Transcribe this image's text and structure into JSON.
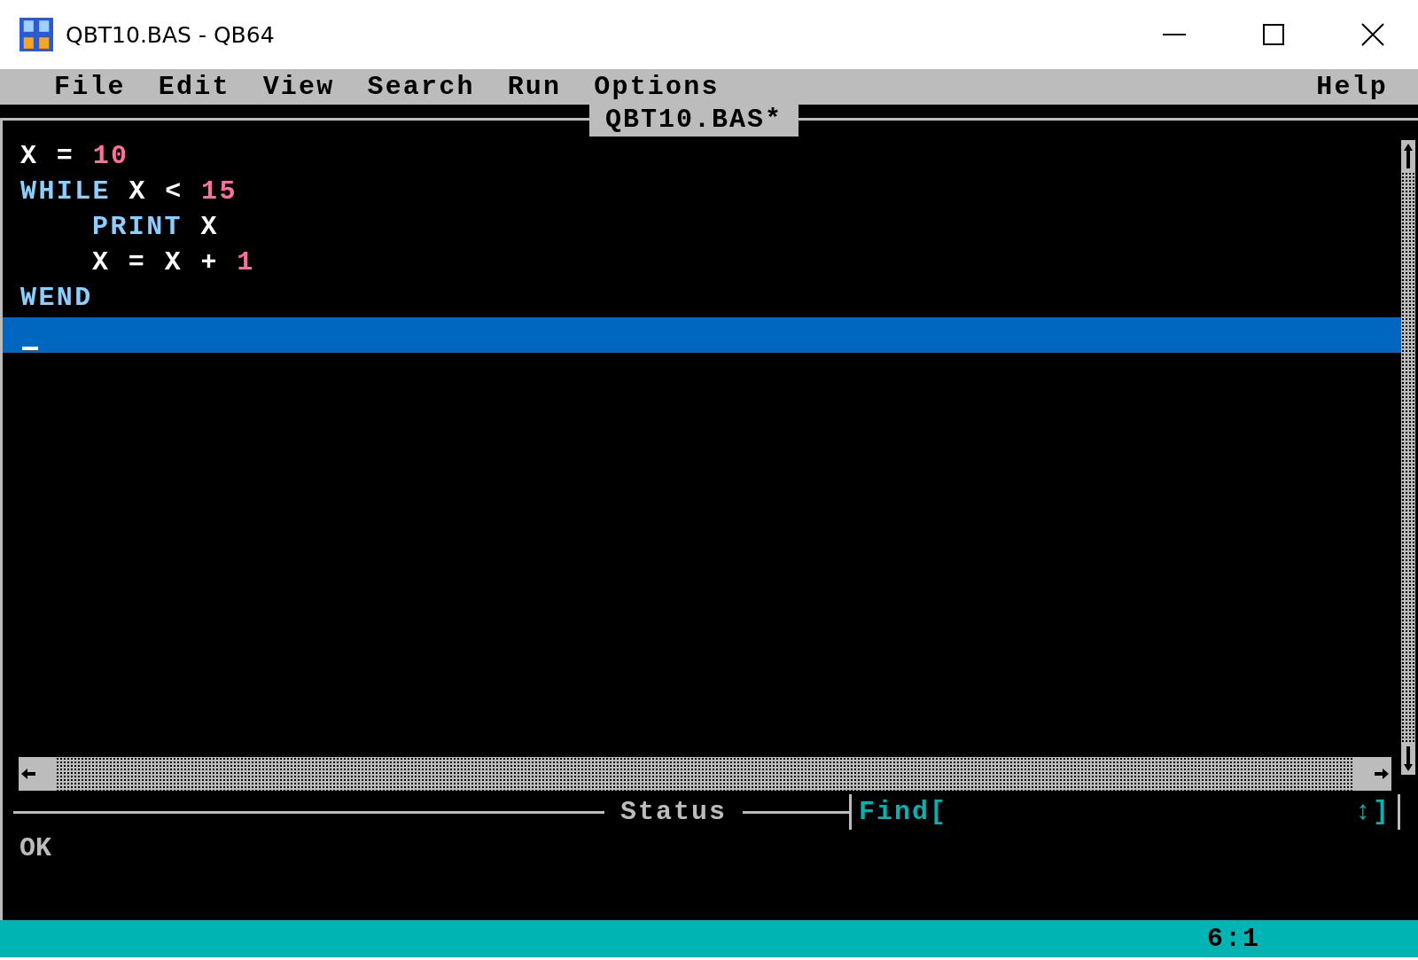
{
  "window": {
    "title": "QBT10.BAS - QB64"
  },
  "menu": {
    "items": [
      {
        "label": "File"
      },
      {
        "label": "Edit"
      },
      {
        "label": "View"
      },
      {
        "label": "Search"
      },
      {
        "label": "Run"
      },
      {
        "label": "Options"
      }
    ],
    "help": "Help"
  },
  "editor": {
    "title": "QBT10.BAS*",
    "lines": [
      {
        "current": false,
        "tokens": [
          {
            "text": "X",
            "kind": "ident"
          },
          {
            "text": "=",
            "kind": "op"
          },
          {
            "text": "10",
            "kind": "number"
          }
        ]
      },
      {
        "current": false,
        "tokens": [
          {
            "text": "WHILE",
            "kind": "keyword"
          },
          {
            "text": "X",
            "kind": "ident"
          },
          {
            "text": "<",
            "kind": "op"
          },
          {
            "text": "15",
            "kind": "number"
          }
        ],
        "children": [
          {
            "current": false,
            "tokens": [
              {
                "text": "PRINT",
                "kind": "keyword"
              },
              {
                "text": "X",
                "kind": "ident"
              }
            ]
          },
          {
            "current": false,
            "tokens": [
              {
                "text": "X",
                "kind": "ident"
              },
              {
                "text": "=",
                "kind": "op"
              },
              {
                "text": "X",
                "kind": "ident"
              },
              {
                "text": "+",
                "kind": "op"
              },
              {
                "text": "1",
                "kind": "number"
              }
            ]
          }
        ]
      },
      {
        "current": false,
        "tokens": [
          {
            "text": "WEND",
            "kind": "keyword"
          }
        ]
      },
      {
        "current": true
      }
    ]
  },
  "status_divider": {
    "label": "Status",
    "find": "Find[",
    "find_end": "↕]"
  },
  "immediate": {
    "text": "OK"
  },
  "status_bar": {
    "position": "6:1"
  }
}
